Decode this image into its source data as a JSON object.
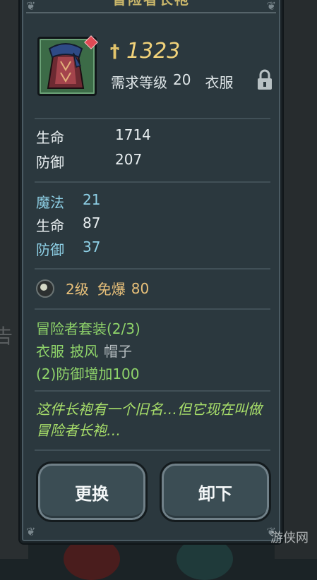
{
  "background": {
    "side_text": "告"
  },
  "panel": {
    "title": "冒险者长袍"
  },
  "item": {
    "power": "1323",
    "required_level_label": "需求等级",
    "required_level": "20",
    "item_type": "衣服"
  },
  "base_stats": [
    {
      "label": "生命",
      "value": "1714"
    },
    {
      "label": "防御",
      "value": "207"
    }
  ],
  "extra_stats": [
    {
      "label": "魔法",
      "value": "21",
      "color": "#8ed0e6"
    },
    {
      "label": "生命",
      "value": "87",
      "color": "#e8eef0"
    },
    {
      "label": "防御",
      "value": "37",
      "color": "#8ed0e6"
    }
  ],
  "gem_slot": {
    "level": "2级",
    "attribute": "免爆",
    "value": "80"
  },
  "set_bonus": {
    "name": "冒险者套装(2/3)",
    "pieces": [
      "衣服",
      "披风",
      "帽子"
    ],
    "bonus": "(2)防御增加100"
  },
  "flavor_text": "这件长袍有一个旧名…但它现在叫做冒险者长袍…",
  "buttons": {
    "change": "更换",
    "unequip": "卸下"
  },
  "watermark": "游侠网"
}
